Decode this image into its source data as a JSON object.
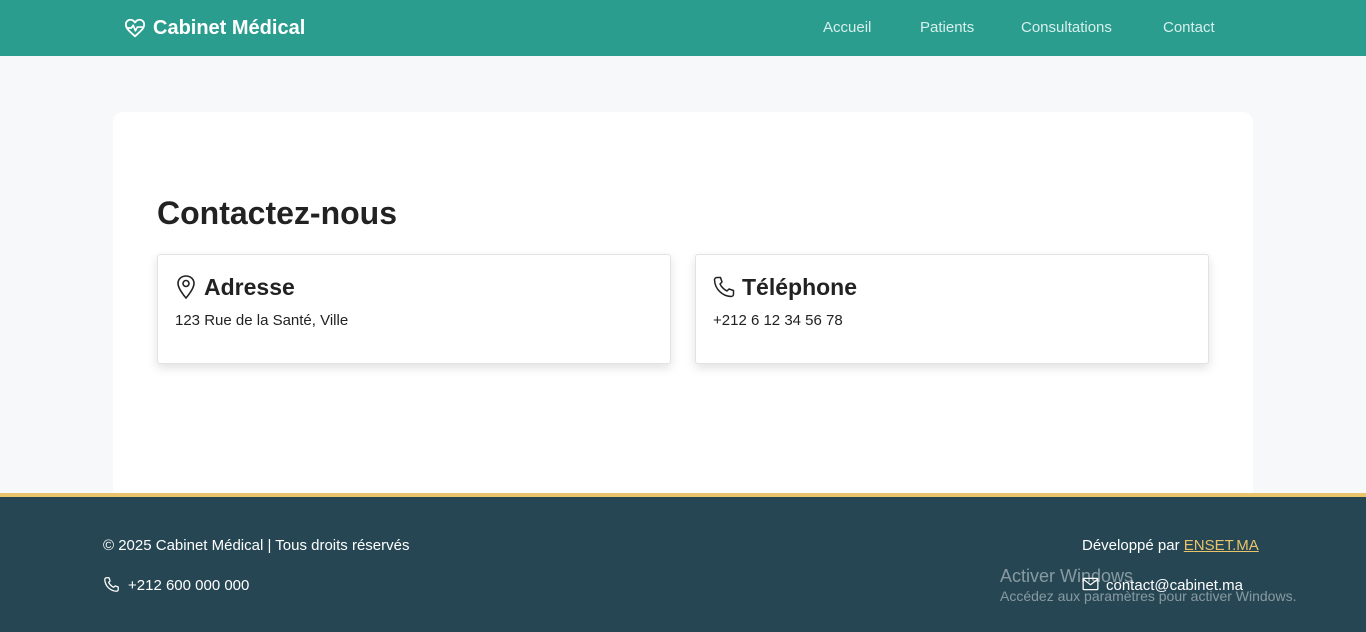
{
  "brand": {
    "name": "Cabinet Médical",
    "icon": "heart-pulse-icon"
  },
  "nav": {
    "items": [
      {
        "label": "Accueil"
      },
      {
        "label": "Patients"
      },
      {
        "label": "Consultations"
      },
      {
        "label": "Contact"
      }
    ]
  },
  "main": {
    "title": "Contactez-nous",
    "cards": [
      {
        "icon": "map-pin-icon",
        "title": "Adresse",
        "text": "123 Rue de la Santé, Ville"
      },
      {
        "icon": "phone-icon",
        "title": "Téléphone",
        "text": "+212 6 12 34 56 78"
      }
    ]
  },
  "footer": {
    "copyright": "© 2025 Cabinet Médical | Tous droits réservés",
    "dev_prefix": "Développé par",
    "dev_link": "ENSET.MA",
    "phone": "+212 600 000 000",
    "email": "contact@cabinet.ma"
  },
  "watermark": {
    "title": "Activer Windows",
    "subtitle": "Accédez aux paramètres pour activer Windows."
  },
  "colors": {
    "navbar": "#2a9d8f",
    "footer": "#264653",
    "accent": "#e9c46a",
    "background": "#f7f8fa"
  }
}
